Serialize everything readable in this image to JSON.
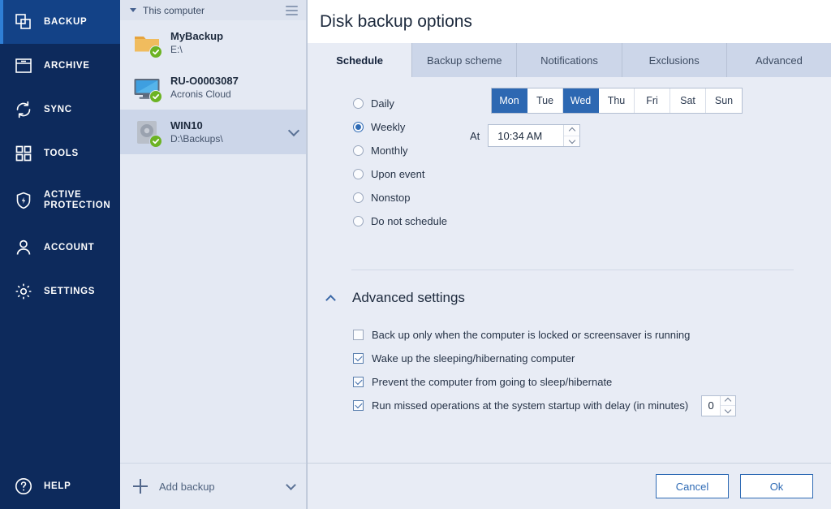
{
  "sidebar": {
    "items": [
      {
        "label": "BACKUP",
        "icon": "backup-copies-icon",
        "active": true
      },
      {
        "label": "ARCHIVE",
        "icon": "archive-box-icon",
        "active": false
      },
      {
        "label": "SYNC",
        "icon": "sync-arrows-icon",
        "active": false
      },
      {
        "label": "TOOLS",
        "icon": "grid-squares-icon",
        "active": false
      },
      {
        "label": "ACTIVE PROTECTION",
        "icon": "shield-bolt-icon",
        "active": false
      },
      {
        "label": "ACCOUNT",
        "icon": "person-icon",
        "active": false
      },
      {
        "label": "SETTINGS",
        "icon": "gear-icon",
        "active": false
      }
    ],
    "help": {
      "label": "HELP",
      "icon": "question-circle-icon"
    }
  },
  "list_panel": {
    "header": {
      "title": "This computer",
      "caret_icon": "caret-down-icon",
      "menu_icon": "hamburger-menu-icon"
    },
    "backups": [
      {
        "name": "MyBackup",
        "path": "E:\\",
        "icon": "folder-icon",
        "status_icon": "check-badge-icon",
        "selected": false
      },
      {
        "name": "RU-O0003087",
        "path": "Acronis Cloud",
        "icon": "monitor-icon",
        "status_icon": "check-badge-icon",
        "selected": false
      },
      {
        "name": "WIN10",
        "path": "D:\\Backups\\",
        "icon": "hard-drive-icon",
        "status_icon": "check-badge-icon",
        "selected": true
      }
    ],
    "add_backup": {
      "label": "Add backup",
      "plus_icon": "plus-icon",
      "chevron_icon": "chevron-down-icon"
    }
  },
  "main": {
    "title": "Disk backup options",
    "tabs": [
      {
        "label": "Schedule",
        "active": true
      },
      {
        "label": "Backup scheme",
        "active": false
      },
      {
        "label": "Notifications",
        "active": false
      },
      {
        "label": "Exclusions",
        "active": false
      },
      {
        "label": "Advanced",
        "active": false
      }
    ],
    "schedule": {
      "frequency_options": [
        {
          "label": "Daily",
          "selected": false
        },
        {
          "label": "Weekly",
          "selected": true
        },
        {
          "label": "Monthly",
          "selected": false
        },
        {
          "label": "Upon event",
          "selected": false
        },
        {
          "label": "Nonstop",
          "selected": false
        },
        {
          "label": "Do not schedule",
          "selected": false
        }
      ],
      "days": [
        {
          "label": "Mon",
          "selected": true
        },
        {
          "label": "Tue",
          "selected": false
        },
        {
          "label": "Wed",
          "selected": true
        },
        {
          "label": "Thu",
          "selected": false
        },
        {
          "label": "Fri",
          "selected": false
        },
        {
          "label": "Sat",
          "selected": false
        },
        {
          "label": "Sun",
          "selected": false
        }
      ],
      "at_label": "At",
      "time_value": "10:34 AM"
    },
    "advanced_settings": {
      "title": "Advanced settings",
      "collapse_icon": "chevron-up-icon",
      "checkboxes": [
        {
          "label": "Back up only when the computer is locked or screensaver is running",
          "checked": false
        },
        {
          "label": "Wake up the sleeping/hibernating computer",
          "checked": true
        },
        {
          "label": "Prevent the computer from going to sleep/hibernate",
          "checked": true
        },
        {
          "label": "Run missed operations at the system startup with delay (in minutes)",
          "checked": true,
          "value": "0"
        }
      ]
    },
    "footer": {
      "cancel_label": "Cancel",
      "ok_label": "Ok"
    }
  },
  "colors": {
    "sidebar_bg": "#0d2a5c",
    "sidebar_active": "#134287",
    "accent_blue": "#2f6bb5",
    "day_selected": "#2d68b2",
    "status_green": "#6cb323",
    "panel_bg": "#e8ecf5",
    "list_bg": "#e4e9f3",
    "tab_inactive": "#ccd6e9"
  }
}
